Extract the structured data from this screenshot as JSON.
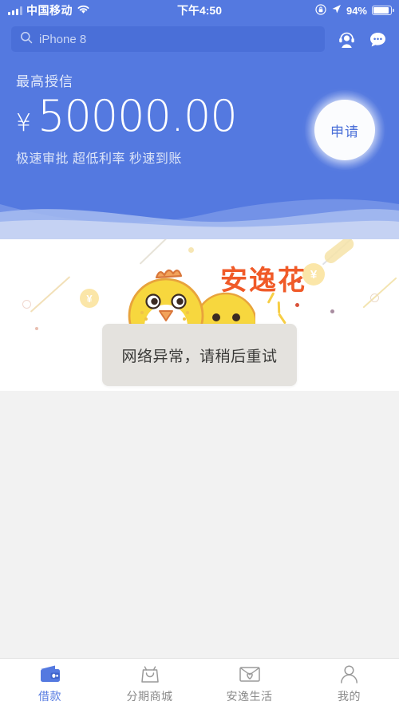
{
  "status_bar": {
    "signal_icon": "signal-bars-icon",
    "carrier": "中国移动",
    "wifi_icon": "wifi-icon",
    "time": "下午4:50",
    "rotation_lock_icon": "rotation-lock-icon",
    "location_icon": "location-arrow-icon",
    "battery_percent": "94%",
    "battery_icon": "battery-icon"
  },
  "header": {
    "search": {
      "icon": "search-icon",
      "placeholder": "iPhone 8",
      "value": "iPhone 8"
    },
    "service_icon": "customer-service-icon",
    "chat_icon": "chat-bubble-icon",
    "credit_label": "最高授信",
    "currency_symbol": "¥",
    "credit_amount": "50000.00",
    "credit_features": "极速审批 超低利率 秒速到账",
    "apply_label": "申请",
    "background_color": "#5479E0"
  },
  "banner": {
    "brand_name": "安逸花",
    "brand_color": "#F05A28",
    "mascot_icon": "yellow-chick-icon",
    "coin_symbol": "¥",
    "coin_color": "#FBE6A8"
  },
  "toast": {
    "message": "网络异常，请稍后重试",
    "background_color": "#E4E2DE",
    "text_color": "#3A3A38"
  },
  "tabbar": {
    "items": [
      {
        "label": "借款",
        "icon": "wallet-icon",
        "active": true
      },
      {
        "label": "分期商城",
        "icon": "shopping-bag-icon",
        "active": false
      },
      {
        "label": "安逸生活",
        "icon": "envelope-heart-icon",
        "active": false
      },
      {
        "label": "我的",
        "icon": "person-icon",
        "active": false
      }
    ],
    "active_color": "#5479E0",
    "inactive_color": "#8A8A8A"
  }
}
